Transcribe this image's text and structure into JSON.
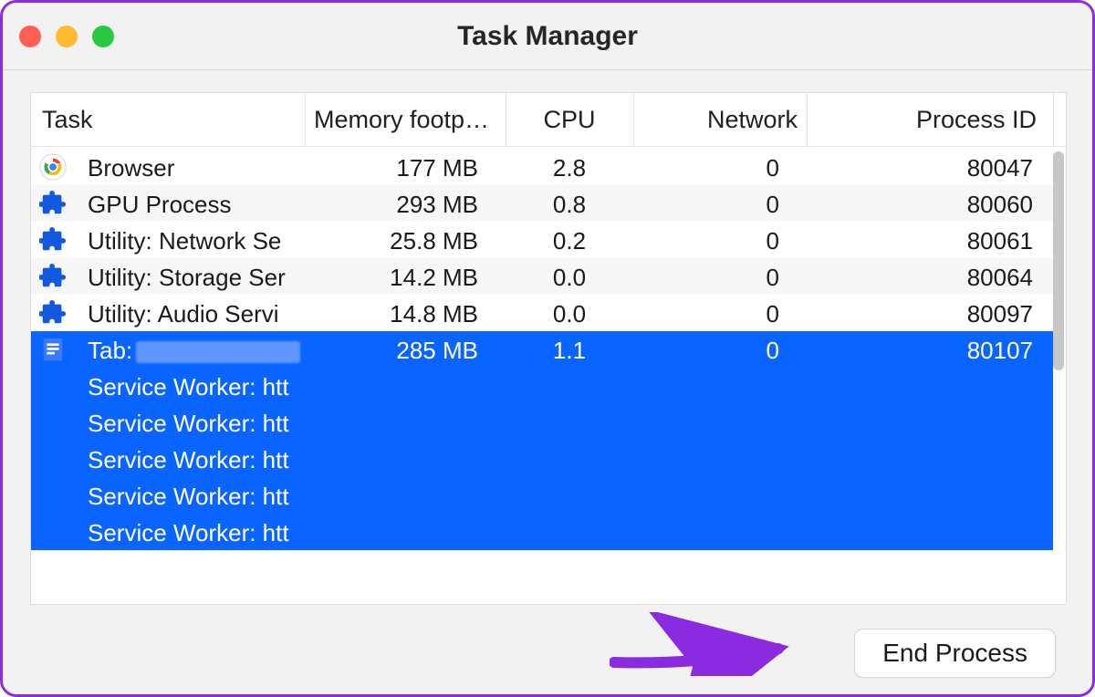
{
  "window": {
    "title": "Task Manager"
  },
  "columns": {
    "task": "Task",
    "memory": "Memory footp…",
    "cpu": "CPU",
    "network": "Network",
    "pid": "Process ID"
  },
  "rows": [
    {
      "icon": "chrome",
      "name": "Browser",
      "memory": "177 MB",
      "cpu": "2.8",
      "network": "0",
      "pid": "80047",
      "selected": false
    },
    {
      "icon": "puzzle",
      "name": "GPU Process",
      "memory": "293 MB",
      "cpu": "0.8",
      "network": "0",
      "pid": "80060",
      "selected": false
    },
    {
      "icon": "puzzle",
      "name": "Utility: Network Se",
      "memory": "25.8 MB",
      "cpu": "0.2",
      "network": "0",
      "pid": "80061",
      "selected": false
    },
    {
      "icon": "puzzle",
      "name": "Utility: Storage Ser",
      "memory": "14.2 MB",
      "cpu": "0.0",
      "network": "0",
      "pid": "80064",
      "selected": false
    },
    {
      "icon": "puzzle",
      "name": "Utility: Audio Servi",
      "memory": "14.8 MB",
      "cpu": "0.0",
      "network": "0",
      "pid": "80097",
      "selected": false
    },
    {
      "icon": "doc",
      "name": "Tab:",
      "memory": "285 MB",
      "cpu": "1.1",
      "network": "0",
      "pid": "80107",
      "selected": true,
      "redacted": true
    },
    {
      "icon": "",
      "name": "Service Worker: htt",
      "memory": "",
      "cpu": "",
      "network": "",
      "pid": "",
      "selected": true
    },
    {
      "icon": "",
      "name": "Service Worker: htt",
      "memory": "",
      "cpu": "",
      "network": "",
      "pid": "",
      "selected": true
    },
    {
      "icon": "",
      "name": "Service Worker: htt",
      "memory": "",
      "cpu": "",
      "network": "",
      "pid": "",
      "selected": true
    },
    {
      "icon": "",
      "name": "Service Worker: htt",
      "memory": "",
      "cpu": "",
      "network": "",
      "pid": "",
      "selected": true
    },
    {
      "icon": "",
      "name": "Service Worker: htt",
      "memory": "",
      "cpu": "",
      "network": "",
      "pid": "",
      "selected": true
    }
  ],
  "footer": {
    "end_process": "End Process"
  }
}
